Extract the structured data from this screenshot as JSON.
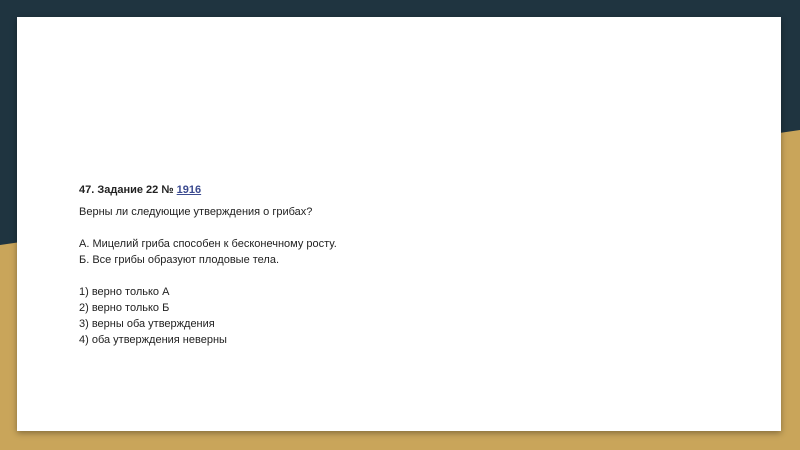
{
  "task": {
    "title_prefix": "47. Задание 22 №",
    "task_number": "1916",
    "question": "Верны ли следующие утверждения о грибах?"
  },
  "statements": [
    "А. Мицелий гриба способен к бесконечному росту.",
    "Б. Все грибы образуют плодовые тела."
  ],
  "options": [
    "1) верно только А",
    "2) верно только Б",
    "3) верны оба утверждения",
    "4) оба утверждения неверны"
  ],
  "colors": {
    "background_dark": "#1f3440",
    "background_gold": "#c9a55a",
    "slide": "#ffffff",
    "link": "#3b4a8f"
  }
}
